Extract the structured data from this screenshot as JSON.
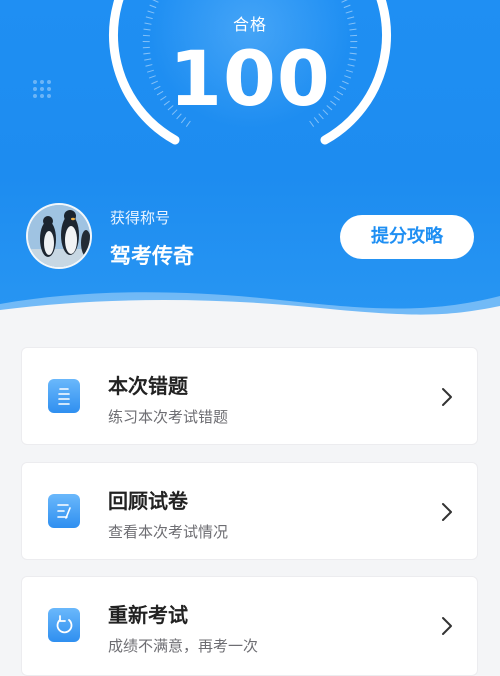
{
  "result": {
    "status_label": "合格",
    "score": "100",
    "score_fraction": 1.0
  },
  "profile": {
    "title_label": "获得称号",
    "title_value": "驾考传奇",
    "avatar_icon": "penguin-avatar"
  },
  "tips_button": {
    "label": "提分攻略"
  },
  "actions": [
    {
      "title": "本次错题",
      "subtitle": "练习本次考试错题",
      "icon": "wrong-questions-icon"
    },
    {
      "title": "回顾试卷",
      "subtitle": "查看本次考试情况",
      "icon": "review-paper-icon"
    },
    {
      "title": "重新考试",
      "subtitle": "成绩不满意，再考一次",
      "icon": "retake-exam-icon"
    }
  ],
  "colors": {
    "primary": "#1f8ff3",
    "card_bg": "#ffffff",
    "page_bg": "#f4f5f7"
  }
}
